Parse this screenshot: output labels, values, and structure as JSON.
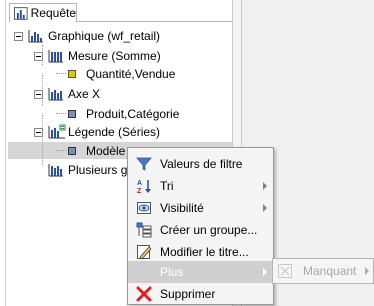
{
  "panel": {
    "tab_label": "Requête"
  },
  "tree": {
    "root": "Graphique (wf_retail)",
    "measure": "Mesure (Somme)",
    "measure_field": "Quantité,Vendue",
    "xaxis": "Axe X",
    "xaxis_field": "Produit,Catégorie",
    "legend": "Légende (Séries)",
    "legend_field": "Modèle",
    "multi": "Plusieurs graphiques"
  },
  "context_menu": {
    "items": [
      {
        "label": "Valeurs de filtre",
        "icon": "filter-icon"
      },
      {
        "label": "Tri",
        "icon": "sort-az-icon",
        "submenu": true
      },
      {
        "label": "Visibilité",
        "icon": "visibility-icon",
        "submenu": true
      },
      {
        "label": "Créer un groupe...",
        "icon": "group-icon"
      },
      {
        "label": "Modifier le titre...",
        "icon": "edit-title-icon"
      },
      {
        "label": "Plus",
        "icon": "",
        "submenu": true,
        "highlighted": true
      },
      {
        "label": "Supprimer",
        "icon": "delete-icon"
      }
    ]
  },
  "submenu": {
    "items": [
      {
        "label": "Manquant",
        "icon": "missing-icon",
        "disabled": true,
        "submenu": true
      }
    ]
  },
  "colors": {
    "menu_highlight": "#cfcfcf",
    "selection": "#d6d6d6",
    "delete_red": "#e02020"
  }
}
